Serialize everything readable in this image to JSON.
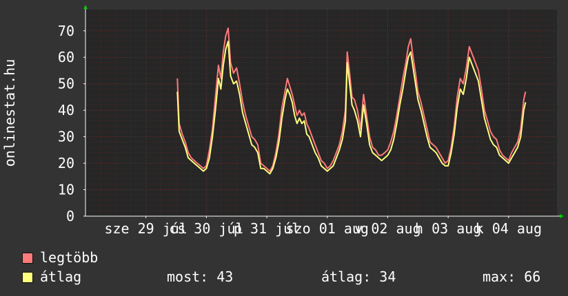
{
  "chart_data": {
    "type": "line",
    "ylabel": "onlinestat.hu",
    "ylim": [
      0,
      78
    ],
    "yticks": [
      0,
      10,
      20,
      30,
      40,
      50,
      60,
      70
    ],
    "grid": true,
    "x_tick_labels": [
      {
        "label": "sze 29 júl",
        "x": 1.0
      },
      {
        "label": "cs 30 júl",
        "x": 2.0
      },
      {
        "label": "p 31 júl",
        "x": 3.0
      },
      {
        "label": "szo 01 aug",
        "x": 4.0
      },
      {
        "label": "v 02 aug",
        "x": 5.0
      },
      {
        "label": "h 03 aug",
        "x": 6.0
      },
      {
        "label": "k 04 aug",
        "x": 7.0
      }
    ],
    "xlim": [
      0,
      7.8
    ],
    "series": [
      {
        "name": "legtöbb",
        "color": "#ff7b7b",
        "points": [
          [
            1.52,
            52
          ],
          [
            1.55,
            35
          ],
          [
            1.6,
            31
          ],
          [
            1.65,
            28
          ],
          [
            1.7,
            24
          ],
          [
            1.75,
            22
          ],
          [
            1.8,
            21
          ],
          [
            1.85,
            20
          ],
          [
            1.9,
            19
          ],
          [
            1.95,
            18
          ],
          [
            2.0,
            19
          ],
          [
            2.05,
            25
          ],
          [
            2.1,
            33
          ],
          [
            2.15,
            45
          ],
          [
            2.2,
            57
          ],
          [
            2.24,
            52
          ],
          [
            2.28,
            62
          ],
          [
            2.32,
            68
          ],
          [
            2.36,
            71
          ],
          [
            2.4,
            58
          ],
          [
            2.45,
            54
          ],
          [
            2.5,
            56
          ],
          [
            2.55,
            50
          ],
          [
            2.6,
            43
          ],
          [
            2.65,
            38
          ],
          [
            2.7,
            34
          ],
          [
            2.75,
            30
          ],
          [
            2.8,
            29
          ],
          [
            2.85,
            27
          ],
          [
            2.9,
            20
          ],
          [
            2.95,
            19
          ],
          [
            3.0,
            18
          ],
          [
            3.05,
            17
          ],
          [
            3.1,
            19
          ],
          [
            3.15,
            24
          ],
          [
            3.2,
            31
          ],
          [
            3.25,
            41
          ],
          [
            3.3,
            47
          ],
          [
            3.34,
            52
          ],
          [
            3.38,
            49
          ],
          [
            3.42,
            46
          ],
          [
            3.46,
            42
          ],
          [
            3.5,
            38
          ],
          [
            3.54,
            40
          ],
          [
            3.58,
            38
          ],
          [
            3.62,
            39
          ],
          [
            3.66,
            35
          ],
          [
            3.7,
            33
          ],
          [
            3.75,
            30
          ],
          [
            3.8,
            27
          ],
          [
            3.85,
            24
          ],
          [
            3.9,
            21
          ],
          [
            3.95,
            20
          ],
          [
            4.0,
            18
          ],
          [
            4.05,
            19
          ],
          [
            4.1,
            21
          ],
          [
            4.15,
            24
          ],
          [
            4.2,
            27
          ],
          [
            4.25,
            32
          ],
          [
            4.3,
            40
          ],
          [
            4.33,
            62
          ],
          [
            4.37,
            54
          ],
          [
            4.41,
            45
          ],
          [
            4.45,
            44
          ],
          [
            4.5,
            40
          ],
          [
            4.55,
            33
          ],
          [
            4.6,
            46
          ],
          [
            4.65,
            38
          ],
          [
            4.7,
            30
          ],
          [
            4.75,
            26
          ],
          [
            4.8,
            25
          ],
          [
            4.85,
            23
          ],
          [
            4.9,
            23
          ],
          [
            4.95,
            24
          ],
          [
            5.0,
            25
          ],
          [
            5.05,
            28
          ],
          [
            5.1,
            32
          ],
          [
            5.15,
            38
          ],
          [
            5.2,
            45
          ],
          [
            5.25,
            52
          ],
          [
            5.3,
            58
          ],
          [
            5.34,
            64
          ],
          [
            5.38,
            67
          ],
          [
            5.42,
            60
          ],
          [
            5.46,
            54
          ],
          [
            5.5,
            47
          ],
          [
            5.55,
            43
          ],
          [
            5.6,
            38
          ],
          [
            5.65,
            33
          ],
          [
            5.7,
            28
          ],
          [
            5.75,
            27
          ],
          [
            5.8,
            26
          ],
          [
            5.85,
            24
          ],
          [
            5.9,
            22
          ],
          [
            5.95,
            20
          ],
          [
            6.0,
            21
          ],
          [
            6.05,
            26
          ],
          [
            6.1,
            34
          ],
          [
            6.15,
            45
          ],
          [
            6.2,
            52
          ],
          [
            6.25,
            50
          ],
          [
            6.3,
            56
          ],
          [
            6.35,
            64
          ],
          [
            6.4,
            61
          ],
          [
            6.45,
            58
          ],
          [
            6.5,
            55
          ],
          [
            6.55,
            48
          ],
          [
            6.6,
            40
          ],
          [
            6.65,
            36
          ],
          [
            6.7,
            32
          ],
          [
            6.75,
            30
          ],
          [
            6.8,
            29
          ],
          [
            6.85,
            25
          ],
          [
            6.9,
            23
          ],
          [
            6.95,
            22
          ],
          [
            7.0,
            21
          ],
          [
            7.05,
            24
          ],
          [
            7.1,
            26
          ],
          [
            7.15,
            28
          ],
          [
            7.2,
            33
          ],
          [
            7.25,
            44
          ],
          [
            7.28,
            47
          ]
        ]
      },
      {
        "name": "átlag",
        "color": "#ffff80",
        "points": [
          [
            1.52,
            47
          ],
          [
            1.55,
            32
          ],
          [
            1.6,
            29
          ],
          [
            1.65,
            26
          ],
          [
            1.7,
            22
          ],
          [
            1.75,
            21
          ],
          [
            1.8,
            20
          ],
          [
            1.85,
            19
          ],
          [
            1.9,
            18
          ],
          [
            1.95,
            17
          ],
          [
            2.0,
            18
          ],
          [
            2.05,
            22
          ],
          [
            2.1,
            30
          ],
          [
            2.15,
            40
          ],
          [
            2.2,
            52
          ],
          [
            2.24,
            48
          ],
          [
            2.28,
            57
          ],
          [
            2.32,
            63
          ],
          [
            2.36,
            66
          ],
          [
            2.4,
            53
          ],
          [
            2.45,
            50
          ],
          [
            2.5,
            51
          ],
          [
            2.55,
            46
          ],
          [
            2.6,
            39
          ],
          [
            2.65,
            35
          ],
          [
            2.7,
            31
          ],
          [
            2.75,
            27
          ],
          [
            2.8,
            26
          ],
          [
            2.85,
            24
          ],
          [
            2.9,
            18
          ],
          [
            2.95,
            18
          ],
          [
            3.0,
            17
          ],
          [
            3.05,
            16
          ],
          [
            3.1,
            18
          ],
          [
            3.15,
            22
          ],
          [
            3.2,
            28
          ],
          [
            3.25,
            37
          ],
          [
            3.3,
            44
          ],
          [
            3.34,
            48
          ],
          [
            3.38,
            46
          ],
          [
            3.42,
            43
          ],
          [
            3.46,
            38
          ],
          [
            3.5,
            35
          ],
          [
            3.54,
            37
          ],
          [
            3.58,
            35
          ],
          [
            3.62,
            36
          ],
          [
            3.66,
            31
          ],
          [
            3.7,
            30
          ],
          [
            3.75,
            27
          ],
          [
            3.8,
            24
          ],
          [
            3.85,
            22
          ],
          [
            3.9,
            19
          ],
          [
            3.95,
            18
          ],
          [
            4.0,
            17
          ],
          [
            4.05,
            18
          ],
          [
            4.1,
            19
          ],
          [
            4.15,
            22
          ],
          [
            4.2,
            25
          ],
          [
            4.25,
            29
          ],
          [
            4.3,
            36
          ],
          [
            4.33,
            58
          ],
          [
            4.37,
            50
          ],
          [
            4.41,
            42
          ],
          [
            4.45,
            40
          ],
          [
            4.5,
            36
          ],
          [
            4.55,
            30
          ],
          [
            4.6,
            42
          ],
          [
            4.65,
            35
          ],
          [
            4.7,
            27
          ],
          [
            4.75,
            24
          ],
          [
            4.8,
            23
          ],
          [
            4.85,
            22
          ],
          [
            4.9,
            21
          ],
          [
            4.95,
            22
          ],
          [
            5.0,
            23
          ],
          [
            5.05,
            25
          ],
          [
            5.1,
            29
          ],
          [
            5.15,
            35
          ],
          [
            5.2,
            42
          ],
          [
            5.25,
            48
          ],
          [
            5.3,
            55
          ],
          [
            5.34,
            60
          ],
          [
            5.38,
            62
          ],
          [
            5.42,
            56
          ],
          [
            5.46,
            50
          ],
          [
            5.5,
            44
          ],
          [
            5.55,
            40
          ],
          [
            5.6,
            35
          ],
          [
            5.65,
            30
          ],
          [
            5.7,
            26
          ],
          [
            5.75,
            25
          ],
          [
            5.8,
            24
          ],
          [
            5.85,
            22
          ],
          [
            5.9,
            20
          ],
          [
            5.95,
            19
          ],
          [
            6.0,
            19
          ],
          [
            6.05,
            24
          ],
          [
            6.1,
            31
          ],
          [
            6.15,
            41
          ],
          [
            6.2,
            48
          ],
          [
            6.25,
            46
          ],
          [
            6.3,
            52
          ],
          [
            6.35,
            60
          ],
          [
            6.4,
            57
          ],
          [
            6.45,
            54
          ],
          [
            6.5,
            51
          ],
          [
            6.55,
            44
          ],
          [
            6.6,
            37
          ],
          [
            6.65,
            33
          ],
          [
            6.7,
            29
          ],
          [
            6.75,
            27
          ],
          [
            6.8,
            26
          ],
          [
            6.85,
            23
          ],
          [
            6.9,
            22
          ],
          [
            6.95,
            21
          ],
          [
            7.0,
            20
          ],
          [
            7.05,
            22
          ],
          [
            7.1,
            24
          ],
          [
            7.15,
            26
          ],
          [
            7.2,
            30
          ],
          [
            7.25,
            40
          ],
          [
            7.28,
            43
          ]
        ]
      }
    ]
  },
  "legend": [
    {
      "name": "legtöbb",
      "color": "#ff7b7b"
    },
    {
      "name": "átlag",
      "color": "#ffff80"
    }
  ],
  "stats": {
    "most": "most: 43",
    "atlag": "átlag: 34",
    "max": "max: 66"
  }
}
